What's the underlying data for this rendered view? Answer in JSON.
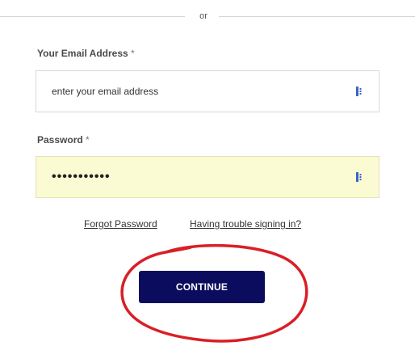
{
  "divider": {
    "text": "or"
  },
  "email": {
    "label": "Your Email Address",
    "required_mark": "*",
    "value": "enter your email address"
  },
  "password": {
    "label": "Password",
    "required_mark": "*",
    "value": "•••••••••••"
  },
  "links": {
    "forgot": "Forgot Password",
    "trouble": "Having trouble signing in?"
  },
  "continue": {
    "label": "CONTINUE"
  },
  "colors": {
    "button_bg": "#0b0c5e",
    "password_bg": "#fafbd2",
    "annotation_circle": "#d91f26",
    "password_manager_icon": "#3a62c8"
  },
  "icons": {
    "password_manager": "password-manager-icon"
  }
}
